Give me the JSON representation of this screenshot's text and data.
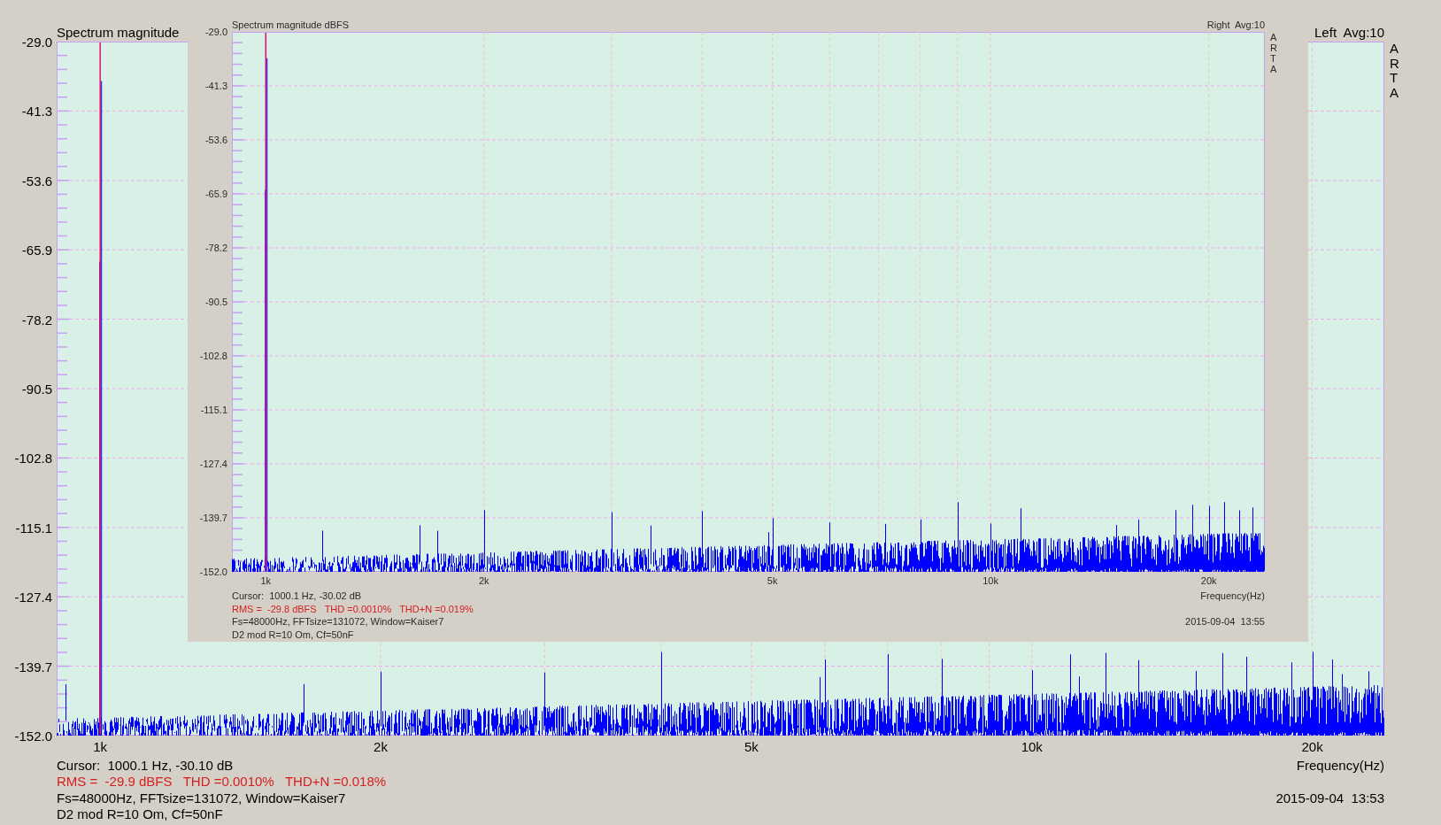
{
  "main_window": {
    "title": "Spectrum magnitude",
    "channel": "Left  Avg:10",
    "logo": "ARTA",
    "y_axis_labels": [
      "-29.0",
      "-41.3",
      "-53.6",
      "-65.9",
      "-78.2",
      "-90.5",
      "-102.8",
      "-115.1",
      "-127.4",
      "-139.7",
      "-152.0"
    ],
    "x_axis_labels": [
      "1k",
      "2k",
      "5k",
      "10k",
      "20k"
    ],
    "x_axis_title": "Frequency(Hz)",
    "cursor": "Cursor:  1000.1 Hz, -30.10 dB",
    "measurements": "RMS =  -29.9 dBFS   THD =0.0010%   THD+N =0.018%",
    "settings": "Fs=48000Hz, FFTsize=131072, Window=Kaiser7",
    "note": "D2 mod R=10 Om, Cf=50nF",
    "timestamp": "2015-09-04  13:53"
  },
  "inset_window": {
    "title": "Spectrum magnitude dBFS",
    "channel": "Right  Avg:10",
    "logo": "ARTA",
    "y_axis_labels": [
      "-29.0",
      "-41.3",
      "-53.6",
      "-65.9",
      "-78.2",
      "-90.5",
      "-102.8",
      "-115.1",
      "-127.4",
      "-139.7",
      "-152.0"
    ],
    "x_axis_labels": [
      "1k",
      "2k",
      "5k",
      "10k",
      "20k"
    ],
    "x_axis_title": "Frequency(Hz)",
    "cursor": "Cursor:  1000.1 Hz, -30.02 dB",
    "measurements": "RMS =  -29.8 dBFS   THD =0.0010%   THD+N =0.019%",
    "settings": "Fs=48000Hz, FFTsize=131072, Window=Kaiser7",
    "note": "D2 mod R=10 Om, Cf=50nF",
    "timestamp": "2015-09-04  13:55"
  }
}
